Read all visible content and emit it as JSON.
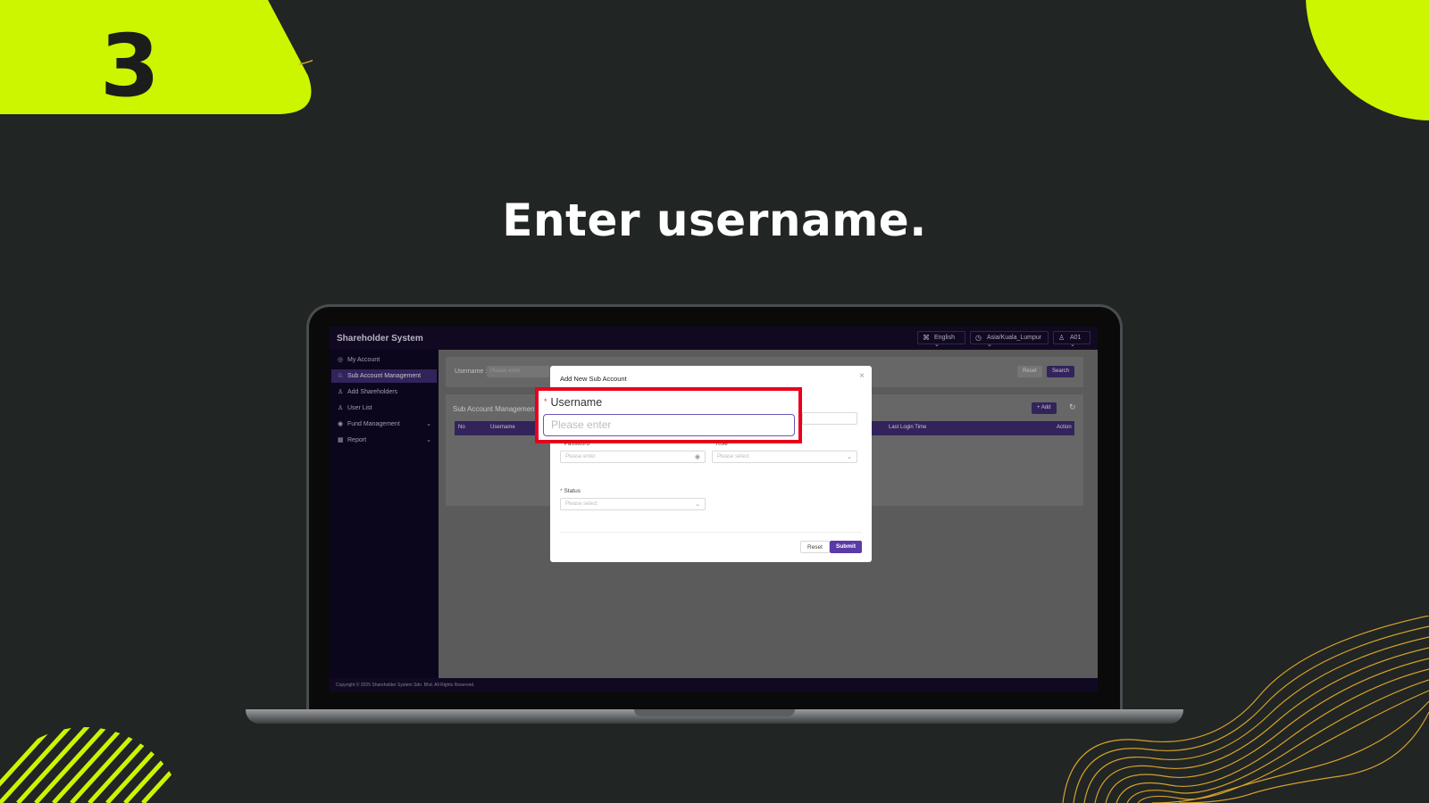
{
  "slide": {
    "step_number": "3",
    "title": "Enter username.",
    "colors": {
      "accent": "#ccf500",
      "background": "#212524",
      "highlight": "#e8001c",
      "brand": "#3b2a6b"
    }
  },
  "app": {
    "brand": "Shareholder System",
    "topbar": {
      "language": "English",
      "timezone": "Asia/Kuala_Lumpur",
      "user": "A01",
      "language_icon": "translate-icon",
      "timezone_icon": "clock-icon",
      "user_icon": "user-icon"
    },
    "sidebar": {
      "items": [
        {
          "label": "My Account",
          "icon": "account-icon"
        },
        {
          "label": "Sub Account Management",
          "icon": "users-icon"
        },
        {
          "label": "Add Shareholders",
          "icon": "user-add-icon"
        },
        {
          "label": "User List",
          "icon": "list-icon"
        },
        {
          "label": "Fund Management",
          "icon": "fund-icon"
        },
        {
          "label": "Report",
          "icon": "report-icon"
        }
      ]
    },
    "filter": {
      "username_label": "Username :",
      "username_placeholder": "Please enter",
      "reset_label": "Reset",
      "search_label": "Search"
    },
    "list": {
      "title": "Sub Account Management",
      "add_label": "+ Add",
      "refresh_icon": "refresh-icon",
      "columns": [
        "No",
        "Username",
        "Last Login Time",
        "Action"
      ]
    },
    "footer": "Copyright © 2025 Shareholder System Sdn. Bhd. All Rights Reserved."
  },
  "modal": {
    "title": "Add New Sub Account",
    "close_icon": "close-icon",
    "fields": {
      "username": {
        "label": "Username",
        "placeholder": "Please enter"
      },
      "password": {
        "label": "Password",
        "placeholder": "Please enter"
      },
      "role": {
        "label": "Role",
        "placeholder": "Please select"
      },
      "status": {
        "label": "Status",
        "placeholder": "Please select"
      }
    },
    "reset_label": "Reset",
    "submit_label": "Submit"
  }
}
